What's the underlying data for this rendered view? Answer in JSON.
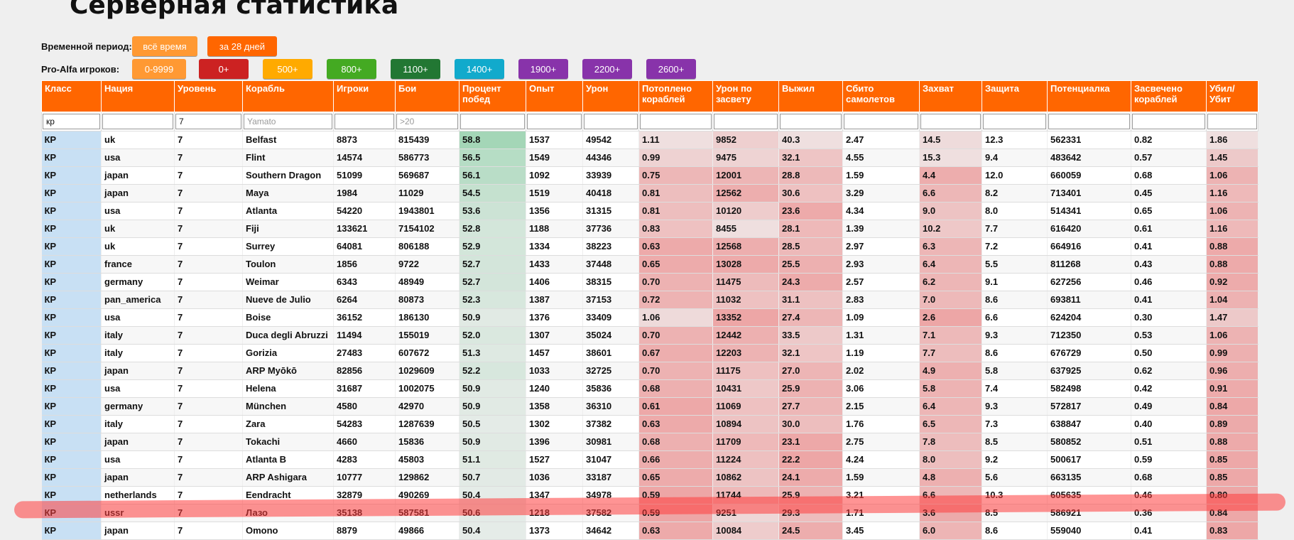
{
  "page": {
    "title": "Серверная статистика"
  },
  "filters": {
    "period_label": "Временной период:",
    "period_buttons": [
      {
        "label": "всё время",
        "color": "#ff9933"
      },
      {
        "label": "за 28 дней",
        "color": "#ff6600"
      }
    ],
    "proalfa_label": "Pro-Alfa игроков:",
    "proalfa_buttons": [
      {
        "label": "0-9999",
        "color": "#ff9933"
      },
      {
        "label": "0+",
        "color": "#cc2222"
      },
      {
        "label": "500+",
        "color": "#ffaa00"
      },
      {
        "label": "800+",
        "color": "#44aa22"
      },
      {
        "label": "1100+",
        "color": "#227733"
      },
      {
        "label": "1400+",
        "color": "#11aacc"
      },
      {
        "label": "1900+",
        "color": "#8833aa"
      },
      {
        "label": "2200+",
        "color": "#8833aa"
      },
      {
        "label": "2600+",
        "color": "#8833aa"
      }
    ]
  },
  "table": {
    "columns": [
      "Класс",
      "Нация",
      "Уровень",
      "Корабль",
      "Игроки",
      "Бои",
      "Процент побед",
      "Опыт",
      "Урон",
      "Потоплено кораблей",
      "Урон по засвету",
      "Выжил",
      "Сбито самолетов",
      "Захват",
      "Защита",
      "Потенциалка",
      "Засвечено кораблей",
      "Убил/Убит"
    ],
    "filter_inputs": [
      {
        "value": "кр",
        "placeholder": ""
      },
      {
        "value": "",
        "placeholder": ""
      },
      {
        "value": "7",
        "placeholder": ""
      },
      {
        "value": "",
        "placeholder": "Yamato"
      },
      {
        "value": "",
        "placeholder": ""
      },
      {
        "value": "",
        "placeholder": ">20"
      },
      {
        "value": "",
        "placeholder": ""
      },
      {
        "value": "",
        "placeholder": ""
      },
      {
        "value": "",
        "placeholder": ""
      },
      {
        "value": "",
        "placeholder": ""
      },
      {
        "value": "",
        "placeholder": ""
      },
      {
        "value": "",
        "placeholder": ""
      },
      {
        "value": "",
        "placeholder": ""
      },
      {
        "value": "",
        "placeholder": ""
      },
      {
        "value": "",
        "placeholder": ""
      },
      {
        "value": "",
        "placeholder": ""
      },
      {
        "value": "",
        "placeholder": ""
      },
      {
        "value": "",
        "placeholder": ""
      }
    ],
    "rows": [
      [
        "КР",
        "uk",
        "7",
        "Belfast",
        "8873",
        "815439",
        "58.8",
        "1537",
        "49542",
        "1.11",
        "9852",
        "40.3",
        "2.47",
        "14.5",
        "12.3",
        "562331",
        "0.82",
        "1.86"
      ],
      [
        "КР",
        "usa",
        "7",
        "Flint",
        "14574",
        "586773",
        "56.5",
        "1549",
        "44346",
        "0.99",
        "9475",
        "32.1",
        "4.55",
        "15.3",
        "9.4",
        "483642",
        "0.57",
        "1.45"
      ],
      [
        "КР",
        "japan",
        "7",
        "Southern Dragon",
        "51099",
        "569687",
        "56.1",
        "1092",
        "33939",
        "0.75",
        "12001",
        "28.8",
        "1.59",
        "4.4",
        "12.0",
        "660059",
        "0.68",
        "1.06"
      ],
      [
        "КР",
        "japan",
        "7",
        "Maya",
        "1984",
        "11029",
        "54.5",
        "1519",
        "40418",
        "0.81",
        "12562",
        "30.6",
        "3.29",
        "6.6",
        "8.2",
        "713401",
        "0.45",
        "1.16"
      ],
      [
        "КР",
        "usa",
        "7",
        "Atlanta",
        "54220",
        "1943801",
        "53.6",
        "1356",
        "31315",
        "0.81",
        "10120",
        "23.6",
        "4.34",
        "9.0",
        "8.0",
        "514341",
        "0.65",
        "1.06"
      ],
      [
        "КР",
        "uk",
        "7",
        "Fiji",
        "133621",
        "7154102",
        "52.8",
        "1188",
        "37736",
        "0.83",
        "8455",
        "28.1",
        "1.39",
        "10.2",
        "7.7",
        "616420",
        "0.61",
        "1.16"
      ],
      [
        "КР",
        "uk",
        "7",
        "Surrey",
        "64081",
        "806188",
        "52.9",
        "1334",
        "38223",
        "0.63",
        "12568",
        "28.5",
        "2.97",
        "6.3",
        "7.2",
        "664916",
        "0.41",
        "0.88"
      ],
      [
        "КР",
        "france",
        "7",
        "Toulon",
        "1856",
        "9722",
        "52.7",
        "1433",
        "37448",
        "0.65",
        "13028",
        "25.5",
        "2.93",
        "6.4",
        "5.5",
        "811268",
        "0.43",
        "0.88"
      ],
      [
        "КР",
        "germany",
        "7",
        "Weimar",
        "6343",
        "48949",
        "52.7",
        "1406",
        "38315",
        "0.70",
        "11475",
        "24.3",
        "2.57",
        "6.2",
        "9.1",
        "627256",
        "0.46",
        "0.92"
      ],
      [
        "КР",
        "pan_america",
        "7",
        "Nueve de Julio",
        "6264",
        "80873",
        "52.3",
        "1387",
        "37153",
        "0.72",
        "11032",
        "31.1",
        "2.83",
        "7.0",
        "8.6",
        "693811",
        "0.41",
        "1.04"
      ],
      [
        "КР",
        "usa",
        "7",
        "Boise",
        "36152",
        "186130",
        "50.9",
        "1376",
        "33409",
        "1.06",
        "13352",
        "27.4",
        "1.09",
        "2.6",
        "6.6",
        "624204",
        "0.30",
        "1.47"
      ],
      [
        "КР",
        "italy",
        "7",
        "Duca degli Abruzzi",
        "11494",
        "155019",
        "52.0",
        "1307",
        "35024",
        "0.70",
        "12442",
        "33.5",
        "1.31",
        "7.1",
        "9.3",
        "712350",
        "0.53",
        "1.06"
      ],
      [
        "КР",
        "italy",
        "7",
        "Gorizia",
        "27483",
        "607672",
        "51.3",
        "1457",
        "38601",
        "0.67",
        "12203",
        "32.1",
        "1.19",
        "7.7",
        "8.6",
        "676729",
        "0.50",
        "0.99"
      ],
      [
        "КР",
        "japan",
        "7",
        "ARP Myōkō",
        "82856",
        "1029609",
        "52.2",
        "1033",
        "32725",
        "0.70",
        "11175",
        "27.0",
        "2.02",
        "4.9",
        "5.8",
        "637925",
        "0.62",
        "0.96"
      ],
      [
        "КР",
        "usa",
        "7",
        "Helena",
        "31687",
        "1002075",
        "50.9",
        "1240",
        "35836",
        "0.68",
        "10431",
        "25.9",
        "3.06",
        "5.8",
        "7.4",
        "582498",
        "0.42",
        "0.91"
      ],
      [
        "КР",
        "germany",
        "7",
        "München",
        "4580",
        "42970",
        "50.9",
        "1358",
        "36310",
        "0.61",
        "11069",
        "27.7",
        "2.15",
        "6.4",
        "9.3",
        "572817",
        "0.49",
        "0.84"
      ],
      [
        "КР",
        "italy",
        "7",
        "Zara",
        "54283",
        "1287639",
        "50.5",
        "1302",
        "37382",
        "0.63",
        "10894",
        "30.0",
        "1.76",
        "6.5",
        "7.3",
        "638847",
        "0.40",
        "0.89"
      ],
      [
        "КР",
        "japan",
        "7",
        "Tokachi",
        "4660",
        "15836",
        "50.9",
        "1396",
        "30981",
        "0.68",
        "11709",
        "23.1",
        "2.75",
        "7.8",
        "8.5",
        "580852",
        "0.51",
        "0.88"
      ],
      [
        "КР",
        "usa",
        "7",
        "Atlanta B",
        "4283",
        "45803",
        "51.1",
        "1527",
        "31047",
        "0.66",
        "11224",
        "22.2",
        "4.24",
        "8.0",
        "9.2",
        "500617",
        "0.59",
        "0.85"
      ],
      [
        "КР",
        "japan",
        "7",
        "ARP Ashigara",
        "10777",
        "129862",
        "50.7",
        "1036",
        "33187",
        "0.65",
        "10862",
        "24.1",
        "1.59",
        "4.8",
        "5.6",
        "663135",
        "0.68",
        "0.85"
      ],
      [
        "КР",
        "netherlands",
        "7",
        "Eendracht",
        "32879",
        "490269",
        "50.4",
        "1347",
        "34978",
        "0.59",
        "11744",
        "25.9",
        "3.21",
        "6.6",
        "10.3",
        "605635",
        "0.46",
        "0.80"
      ],
      [
        "КР",
        "ussr",
        "7",
        "Лазо",
        "35138",
        "587581",
        "50.6",
        "1218",
        "37582",
        "0.59",
        "9251",
        "29.3",
        "1.71",
        "3.6",
        "8.5",
        "586921",
        "0.36",
        "0.84"
      ],
      [
        "КР",
        "japan",
        "7",
        "Omono",
        "8879",
        "49866",
        "50.4",
        "1373",
        "34642",
        "0.63",
        "10084",
        "24.5",
        "3.45",
        "6.0",
        "8.6",
        "559040",
        "0.41",
        "0.83"
      ]
    ]
  },
  "colors": {
    "header": "#ff6600",
    "class_col": "#c8e0f4",
    "good": "#9fd4b4",
    "bad": "#ee8888",
    "highlight": "#ff3c3c"
  }
}
